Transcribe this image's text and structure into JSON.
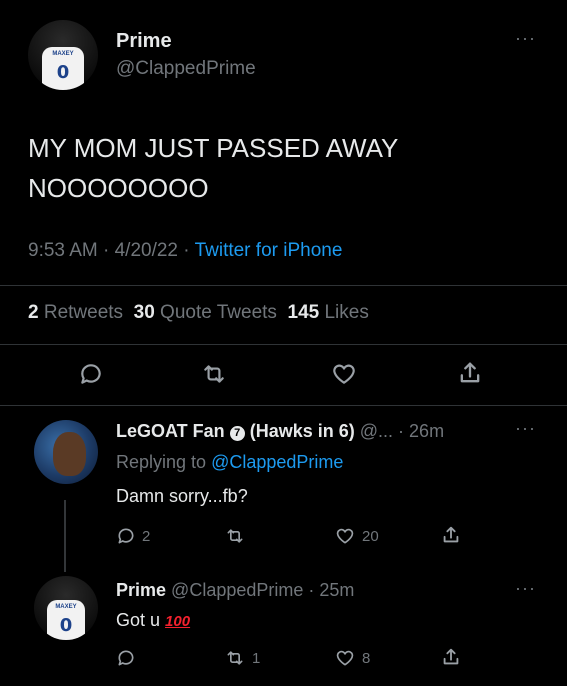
{
  "main_tweet": {
    "display_name": "Prime",
    "handle": "@ClappedPrime",
    "text_line1": "MY MOM JUST PASSED AWAY",
    "text_line2": "NOOOOOOOO",
    "time": "9:53 AM",
    "sep1": " · ",
    "date": "4/20/22",
    "sep2": " · ",
    "source": "Twitter for iPhone",
    "stats": {
      "retweets_count": "2",
      "retweets_label": "Retweets",
      "quotes_count": "30",
      "quotes_label": "Quote Tweets",
      "likes_count": "145",
      "likes_label": "Likes"
    },
    "more": "···"
  },
  "reply1": {
    "display_name": "LeGOAT Fan",
    "verified_glyph": "7",
    "name_suffix": "(Hawks in 6)",
    "handle": "@...",
    "time": "· 26m",
    "replying_prefix": "Replying to",
    "replying_handle": "@ClappedPrime",
    "text": "Damn sorry...fb?",
    "reply_count": "2",
    "retweet_count": "",
    "like_count": "20",
    "more": "···"
  },
  "reply2": {
    "display_name": "Prime",
    "handle": "@ClappedPrime",
    "time": "· 25m",
    "text": "Got u",
    "emoji": "100",
    "reply_count": "",
    "retweet_count": "1",
    "like_count": "8",
    "more": "···"
  },
  "avatar": {
    "jersey_name": "MAXEY",
    "jersey_number": "0"
  },
  "icons": [
    "reply-icon",
    "retweet-icon",
    "like-icon",
    "share-icon",
    "more-icon",
    "verified-icon"
  ],
  "colors": {
    "background": "#000000",
    "text": "#e7e9ea",
    "muted": "#71767b",
    "link": "#1d9bf0"
  }
}
